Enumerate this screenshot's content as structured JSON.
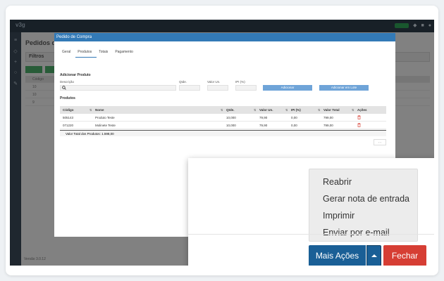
{
  "background_app": {
    "logo": "v3g",
    "page_title": "Pedidos de C",
    "filters_label": "Filtros",
    "table_header_label": "Código",
    "row_labels": [
      "10",
      "10",
      "9"
    ],
    "footer_text": "Versão 3.0.12"
  },
  "modal": {
    "title": "Pedido de Compra",
    "tabs": [
      {
        "label": "Geral"
      },
      {
        "label": "Produtos"
      },
      {
        "label": "Totais"
      },
      {
        "label": "Pagamento"
      }
    ],
    "add_product": {
      "section_label": "Adicionar Produto",
      "descricao_label": "Descrição",
      "qtde_label": "Qtde.",
      "valor_un_label": "Valor Un.",
      "ipi_label": "IPI (%)",
      "add_button": "Adicionar",
      "add_batch_button": "Adicionar em Lote"
    },
    "products": {
      "section_label": "Produtos",
      "columns": [
        "Código",
        "Nome",
        "Qtde.",
        "Valor Un.",
        "IPI (%)",
        "Valor Total",
        "Ações"
      ],
      "rows": [
        {
          "codigo": "505143",
          "nome": "Produto Teste",
          "qtde": "10,000",
          "valor_un": "79,90",
          "ipi": "0,00",
          "valor_total": "799,00"
        },
        {
          "codigo": "071220",
          "nome": "Molinete Teste",
          "qtde": "10,000",
          "valor_un": "79,90",
          "ipi": "0,00",
          "valor_total": "799,00"
        }
      ],
      "total_label": "Valor Total dos Produtos: 1.598,00"
    }
  },
  "actions": {
    "menu_items": [
      {
        "label": "Reabrir"
      },
      {
        "label": "Gerar nota de entrada"
      },
      {
        "label": "Imprimir"
      },
      {
        "label": "Enviar por e-mail"
      }
    ],
    "more_actions_label": "Mais Ações",
    "close_label": "Fechar"
  },
  "colors": {
    "header_blue": "#337ab7",
    "primary": "#1a5f96",
    "danger": "#d63e34",
    "success": "#4aa866"
  },
  "icons": [
    "search-icon",
    "trash-icon",
    "caret-up-icon",
    "bell-icon",
    "grid-icon",
    "user-icon"
  ]
}
